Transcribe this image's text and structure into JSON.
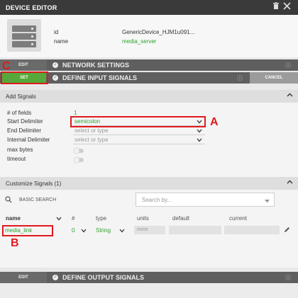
{
  "window": {
    "title": "DEVICE EDITOR"
  },
  "titlebar_icons": [
    "trash-icon",
    "close-icon"
  ],
  "device": {
    "id_label": "id",
    "id_value": "GenericDevice_HJM1u091...",
    "name_label": "name",
    "name_value": "media_server"
  },
  "network_settings": {
    "edit_label": "EDIT",
    "title": "NETWORK SETTINGS"
  },
  "input_signals": {
    "set_label": "SET",
    "title": "DEFINE INPUT SIGNALS",
    "cancel_label": "CANCEL"
  },
  "add_signals": {
    "title": "Add Signals",
    "fields_label": "# of fields",
    "fields_value": "1",
    "start_delimiter_label": "Start Delimiter",
    "start_delimiter_value": "semicolon",
    "end_delimiter_label": "End Delimiter",
    "end_delimiter_placeholder": "select or type",
    "internal_delimiter_label": "Internal Delimiter",
    "internal_delimiter_placeholder": "select or type",
    "max_bytes_label": "max bytes",
    "timeout_label": "timeout"
  },
  "customize_signals": {
    "title": "Customize Signals (1)",
    "basic_search_label": "BASIC SEARCH",
    "search_placeholder": "Search by...",
    "columns": {
      "name": "name",
      "num": "#",
      "type": "type",
      "units": "units",
      "default": "default",
      "current": "current"
    },
    "rows": [
      {
        "name": "media_link",
        "num": "0",
        "type": "String",
        "units": "none",
        "default": "",
        "current": ""
      }
    ]
  },
  "output_signals": {
    "edit_label": "EDIT",
    "title": "DEFINE OUTPUT SIGNALS"
  },
  "annotations": {
    "a": "A",
    "b": "B",
    "c": "C"
  },
  "colors": {
    "accent_green": "#55a839",
    "annotation_red": "#e0191e",
    "section_bar": "#5f5f5f"
  }
}
